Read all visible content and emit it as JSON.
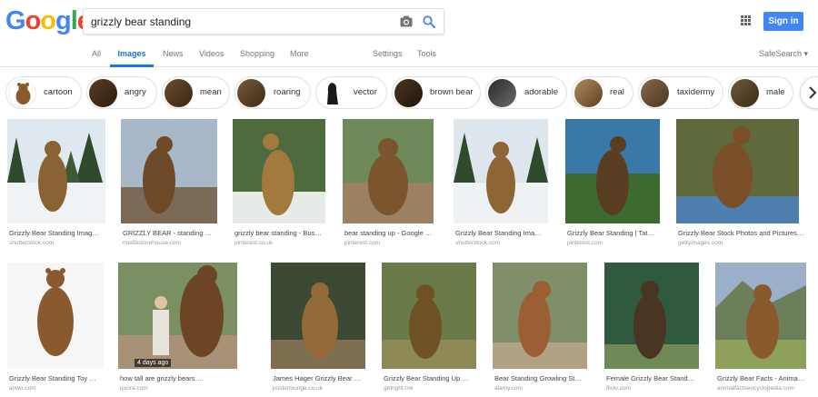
{
  "logo": {
    "letters": [
      "G",
      "o",
      "o",
      "g",
      "l",
      "e"
    ]
  },
  "search": {
    "query": "grizzly bear standing",
    "placeholder": ""
  },
  "header": {
    "signin_label": "Sign in"
  },
  "nav": {
    "tabs": [
      "All",
      "Images",
      "News",
      "Videos",
      "Shopping",
      "More"
    ],
    "active_tab": "Images",
    "settings": "Settings",
    "tools": "Tools",
    "safesearch": "SafeSearch ▾"
  },
  "chips": [
    {
      "label": "cartoon"
    },
    {
      "label": "angry"
    },
    {
      "label": "mean"
    },
    {
      "label": "roaring"
    },
    {
      "label": "vector"
    },
    {
      "label": "brown bear"
    },
    {
      "label": "adorable"
    },
    {
      "label": "real"
    },
    {
      "label": "taxidermy"
    },
    {
      "label": "male"
    }
  ],
  "results_row1": [
    {
      "title": "Grizzly Bear Standing Imag…",
      "source": "shutterstock.com"
    },
    {
      "title": "GRIZZLY BEAR - standing …",
      "source": "mediastorehouse.com"
    },
    {
      "title": "grizzly bear standing - Bus…",
      "source": "pinterest.co.uk"
    },
    {
      "title": "bear standing up - Google …",
      "source": "pinterest.com"
    },
    {
      "title": "Grizzly Bear Standing Ima…",
      "source": "shutterstock.com"
    },
    {
      "title": "Grizzly Bear Standing | Tat…",
      "source": "pinterest.com"
    },
    {
      "title": "Grizzly Bear Stock Photos and Pictures…",
      "source": "gettyimages.com"
    }
  ],
  "results_row2": [
    {
      "title": "Grizzly Bear Standing Toy …",
      "source": "anwo.com"
    },
    {
      "title": "how tall are grizzly bears …",
      "source": "quora.com",
      "badge": "4 days ago"
    },
    {
      "title": "James Hager Grizzly Bear …",
      "source": "posterlounge.co.uk"
    },
    {
      "title": "Grizzly Bear Standing Up …",
      "source": "getright.me"
    },
    {
      "title": "Bear Standing Growling St…",
      "source": "alamy.com"
    },
    {
      "title": "Female Grizzly Bear Stand…",
      "source": "flickr.com"
    },
    {
      "title": "Grizzly Bear Facts - Anima…",
      "source": "animalfactsencyclopedia.com"
    }
  ],
  "colors": {
    "accent": "#1a73e8",
    "signin": "#4285f4"
  }
}
